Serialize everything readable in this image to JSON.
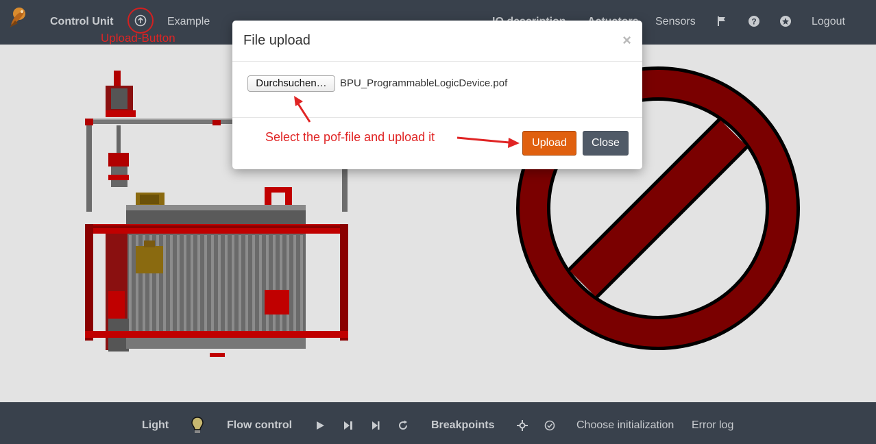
{
  "navbar": {
    "brand": "Control Unit",
    "upload_icon": "arrow-circle-up-icon",
    "example": "Example",
    "io_description": "IO description",
    "actuators": "Actuators",
    "sensors": "Sensors",
    "flag_icon": "flag-icon",
    "help_icon": "question-circle-icon",
    "settings_icon": "star-circle-icon",
    "logout": "Logout",
    "upload_annotation": "Upload-Button"
  },
  "modal": {
    "title": "File upload",
    "close_glyph": "×",
    "browse_label": "Durchsuchen…",
    "file_name": "BPU_ProgrammableLogicDevice.pof",
    "annotation": "Select the pof-file and upload it",
    "upload_label": "Upload",
    "close_label": "Close"
  },
  "bottombar": {
    "light": "Light",
    "lightbulb_icon": "lightbulb-icon",
    "flow_control": "Flow control",
    "play_icon": "play-icon",
    "step_icon": "step-forward-icon",
    "skip_icon": "skip-forward-icon",
    "reset_icon": "redo-icon",
    "breakpoints": "Breakpoints",
    "crosshair_icon": "crosshair-icon",
    "check_icon": "check-circle-icon",
    "choose_initialization": "Choose initialization",
    "error_log": "Error log"
  },
  "colors": {
    "navbar_bg": "#39414c",
    "nav_text": "#c8cbcf",
    "accent_orange": "#e0600f",
    "close_gray": "#505a67",
    "annotation_red": "#e02424",
    "forbidden_red": "#7a0000"
  }
}
